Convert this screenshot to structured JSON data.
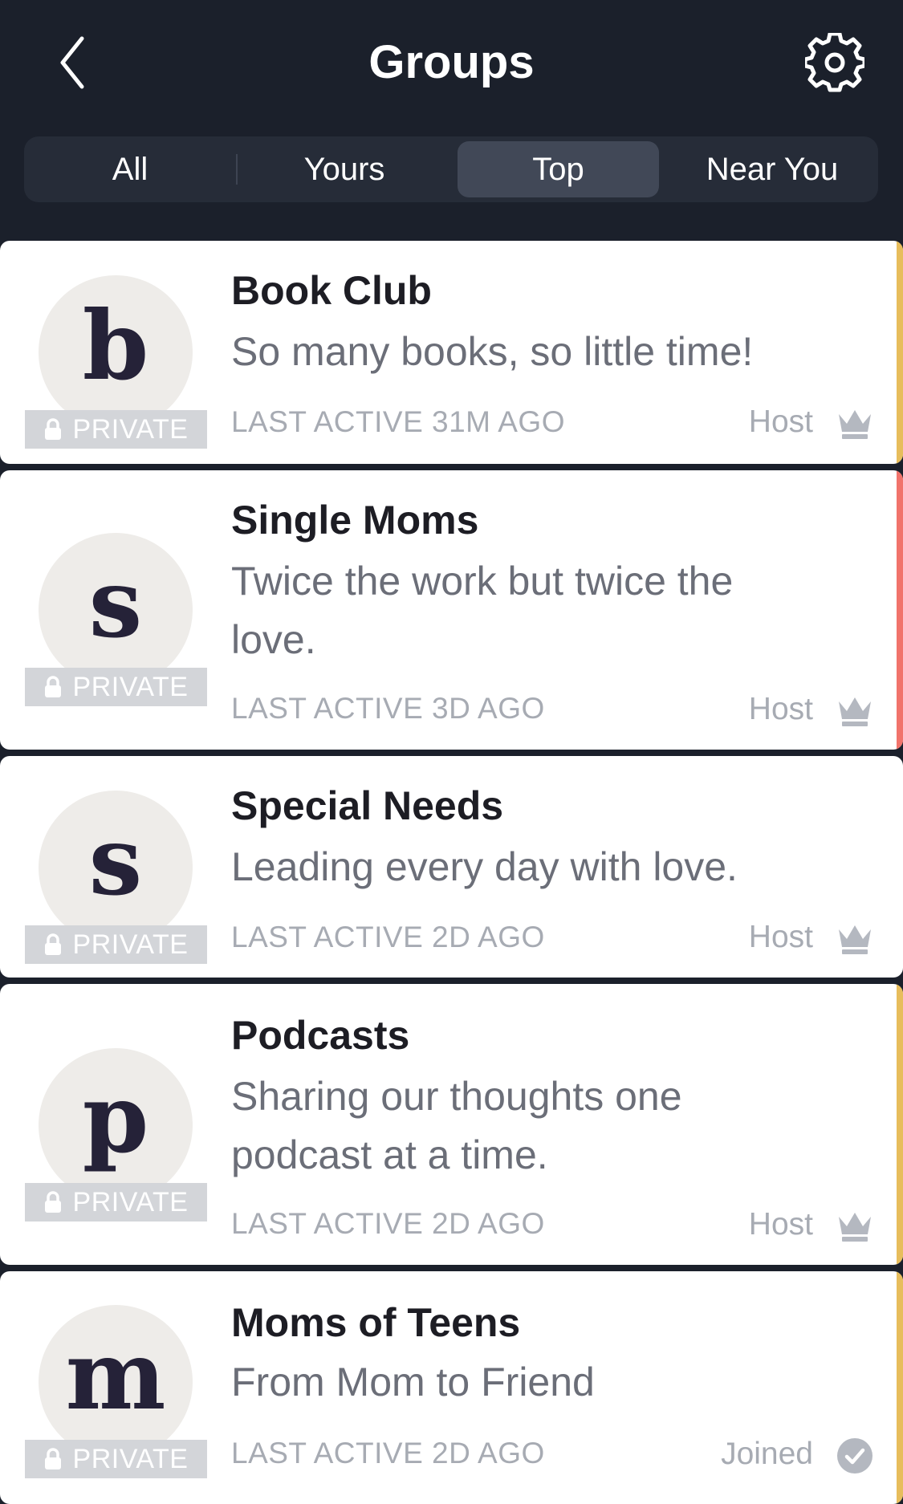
{
  "header": {
    "title": "Groups",
    "back_icon": "chevron-left-icon",
    "settings_icon": "gear-icon"
  },
  "tabs": [
    {
      "label": "All",
      "active": false
    },
    {
      "label": "Yours",
      "active": false
    },
    {
      "label": "Top",
      "active": true
    },
    {
      "label": "Near You",
      "active": false
    }
  ],
  "colors": {
    "background": "#1b202b",
    "accent_yellow": "#e7bd5c",
    "accent_red": "#f1736b",
    "private_badge": "#d3d5d9"
  },
  "groups": [
    {
      "letter": "b",
      "name": "Book Club",
      "description": "So many books, so little time!",
      "privacy": "PRIVATE",
      "last_active": "LAST ACTIVE 31M AGO",
      "role": "Host",
      "role_icon": "crown-icon",
      "accent": "#e7bd5c"
    },
    {
      "letter": "s",
      "name": "Single Moms",
      "description": "Twice the work but twice the love.",
      "privacy": "PRIVATE",
      "last_active": "LAST ACTIVE 3D AGO",
      "role": "Host",
      "role_icon": "crown-icon",
      "accent": "#f1736b"
    },
    {
      "letter": "s",
      "name": "Special Needs",
      "description": "Leading every day with love.",
      "privacy": "PRIVATE",
      "last_active": "LAST ACTIVE 2D AGO",
      "role": "Host",
      "role_icon": "crown-icon",
      "accent": ""
    },
    {
      "letter": "p",
      "name": "Podcasts",
      "description": "Sharing our thoughts one podcast at a time.",
      "privacy": "PRIVATE",
      "last_active": "LAST ACTIVE 2D AGO",
      "role": "Host",
      "role_icon": "crown-icon",
      "accent": "#e7bd5c"
    },
    {
      "letter": "m",
      "name": "Moms of Teens",
      "description": "From Mom to Friend",
      "privacy": "PRIVATE",
      "last_active": "LAST ACTIVE 2D AGO",
      "role": "Joined",
      "role_icon": "checkmark-circle-icon",
      "accent": "#e7bd5c"
    }
  ]
}
